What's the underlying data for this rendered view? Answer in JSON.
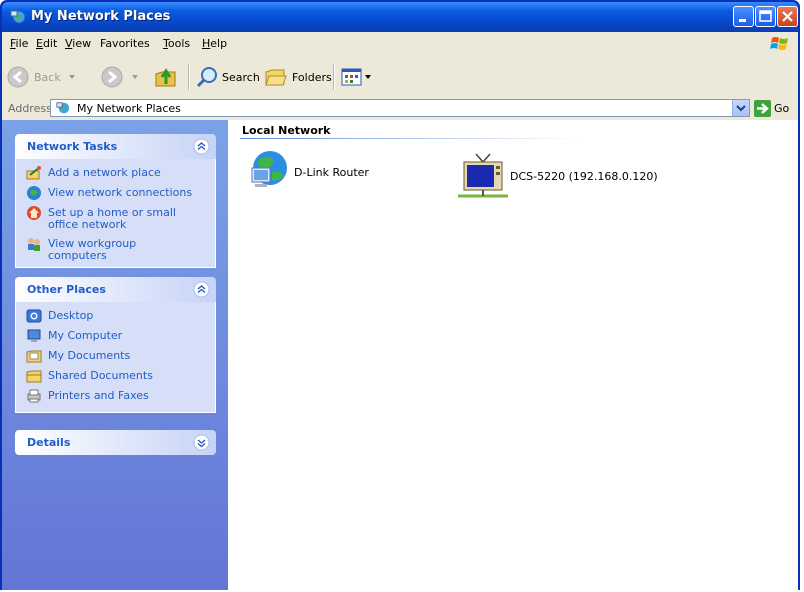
{
  "window": {
    "title": "My Network Places",
    "icon": "network-places-icon"
  },
  "menu": [
    {
      "label": "File",
      "accel": "F",
      "rest": "ile"
    },
    {
      "label": "Edit",
      "accel": "E",
      "rest": "dit"
    },
    {
      "label": "View",
      "accel": "V",
      "rest": "iew"
    },
    {
      "label": "Favorites",
      "accel": "",
      "rest": "Favorites"
    },
    {
      "label": "Tools",
      "accel": "T",
      "rest": "ools"
    },
    {
      "label": "Help",
      "accel": "H",
      "rest": "elp"
    }
  ],
  "toolbar": {
    "back": "Back",
    "search": "Search",
    "folders": "Folders"
  },
  "address": {
    "label": "Address",
    "value": "My Network Places",
    "go": "Go"
  },
  "network_tasks": {
    "title": "Network Tasks",
    "items": [
      {
        "label": "Add a network place",
        "icon": "add-network-place-icon"
      },
      {
        "label": "View network connections",
        "icon": "network-connections-icon"
      },
      {
        "label": "Set up a home or small office network",
        "icon": "home-network-icon"
      },
      {
        "label": "View workgroup computers",
        "icon": "workgroup-icon"
      }
    ]
  },
  "other_places": {
    "title": "Other Places",
    "items": [
      {
        "label": "Desktop",
        "icon": "desktop-icon"
      },
      {
        "label": "My Computer",
        "icon": "my-computer-icon"
      },
      {
        "label": "My Documents",
        "icon": "my-documents-icon"
      },
      {
        "label": "Shared Documents",
        "icon": "shared-folder-icon"
      },
      {
        "label": "Printers and Faxes",
        "icon": "printer-icon"
      }
    ]
  },
  "details": {
    "title": "Details"
  },
  "content": {
    "group": "Local Network",
    "items": [
      {
        "label": "D-Link Router",
        "icon": "network-globe-icon"
      },
      {
        "label": "DCS-5220 (192.168.0.120)",
        "icon": "network-camera-tv-icon"
      }
    ]
  }
}
